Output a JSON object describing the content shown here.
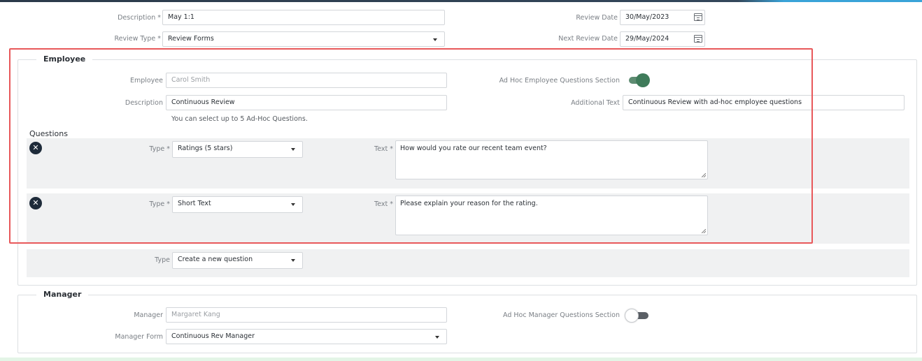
{
  "header": {
    "description": {
      "label": "Description *",
      "value": "May 1:1"
    },
    "review_type": {
      "label": "Review Type *",
      "value": "Review Forms"
    },
    "review_date": {
      "label": "Review Date",
      "value": "30/May/2023"
    },
    "next_review_date": {
      "label": "Next Review Date",
      "value": "29/May/2024"
    }
  },
  "employee": {
    "legend": "Employee",
    "employee": {
      "label": "Employee",
      "value": "Carol Smith"
    },
    "description": {
      "label": "Description",
      "value": "Continuous Review"
    },
    "hint": "You can select up to 5 Ad-Hoc Questions.",
    "adhoc_section": {
      "label": "Ad Hoc Employee Questions Section",
      "enabled": true
    },
    "additional_text": {
      "label": "Additional Text",
      "value": "Continuous Review with ad-hoc employee questions"
    },
    "questions_heading": "Questions",
    "questions": [
      {
        "type_label": "Type *",
        "type_value": "Ratings (5 stars)",
        "text_label": "Text *",
        "text_value": "How would you rate our recent team event?",
        "remove_icon": "x"
      },
      {
        "type_label": "Type *",
        "type_value": "Short Text",
        "text_label": "Text *",
        "text_value": "Please explain your reason for the rating.",
        "remove_icon": "x"
      }
    ],
    "new_question": {
      "label": "Type",
      "value": "Create a new question"
    }
  },
  "manager": {
    "legend": "Manager",
    "manager": {
      "label": "Manager",
      "value": "Margaret Kang"
    },
    "manager_form": {
      "label": "Manager Form",
      "value": "Continuous Rev Manager"
    },
    "adhoc_section": {
      "label": "Ad Hoc Manager Questions Section",
      "enabled": false
    }
  },
  "colors": {
    "highlight": "#e8585a",
    "toggle_on": "#3f7b5a",
    "remove_button": "#1e2b3a",
    "question_row_bg": "#f0f1f2"
  }
}
